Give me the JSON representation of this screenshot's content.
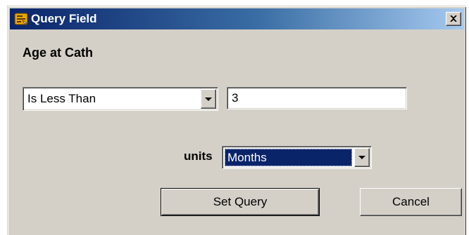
{
  "window": {
    "title": "Query Field",
    "icons": {
      "app": "database-query-icon",
      "close": "close-icon"
    }
  },
  "field": {
    "label": "Age at Cath"
  },
  "operator": {
    "selected": "Is Less Than"
  },
  "value_input": {
    "value": "3"
  },
  "units": {
    "label": "units",
    "selected": "Months"
  },
  "buttons": {
    "set_query": "Set Query",
    "cancel": "Cancel"
  },
  "colors": {
    "titlebar_start": "#0a246a",
    "titlebar_end": "#a6caf0",
    "dialog_bg": "#d4d0c8",
    "selection": "#0a246a"
  }
}
